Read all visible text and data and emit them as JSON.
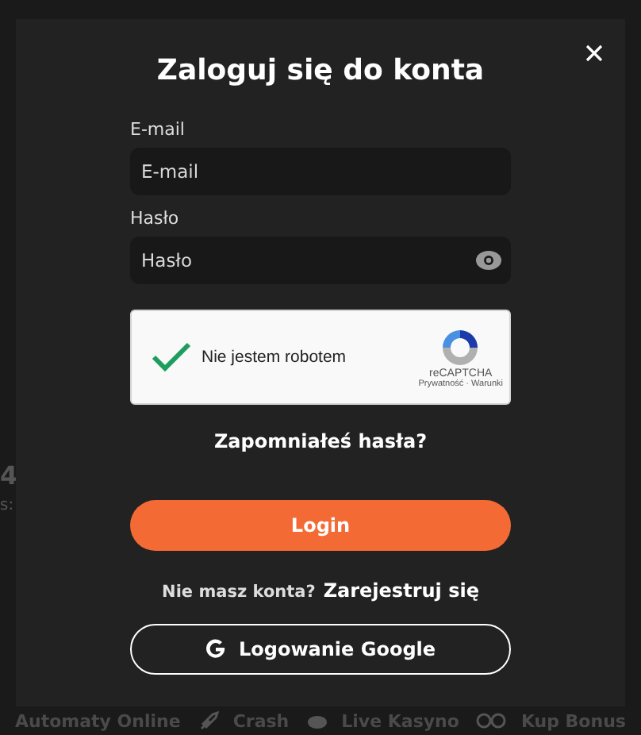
{
  "background": {
    "side_texts": [
      "4",
      "s:"
    ],
    "nav": [
      {
        "label": "Automaty Online"
      },
      {
        "label": "Crash"
      },
      {
        "label": "Live Kasyno"
      },
      {
        "label": "Kup Bonus"
      }
    ]
  },
  "dialog": {
    "title": "Zaloguj się do konta",
    "fields": [
      {
        "label": "E-mail",
        "placeholder": "E-mail",
        "kind": "text"
      },
      {
        "label": "Hasło",
        "placeholder": "Hasło",
        "kind": "password"
      }
    ],
    "captcha": {
      "label": "Nie jestem robotem",
      "checked": true,
      "brand": "reCAPTCHA",
      "links": "Prywatność · Warunki"
    },
    "forgot": "Zapomniałeś hasła?",
    "login_button": "Login",
    "register_prompt": "Nie masz konta?",
    "register_link": "Zarejestruj się",
    "google_button": "Logowanie Google"
  }
}
